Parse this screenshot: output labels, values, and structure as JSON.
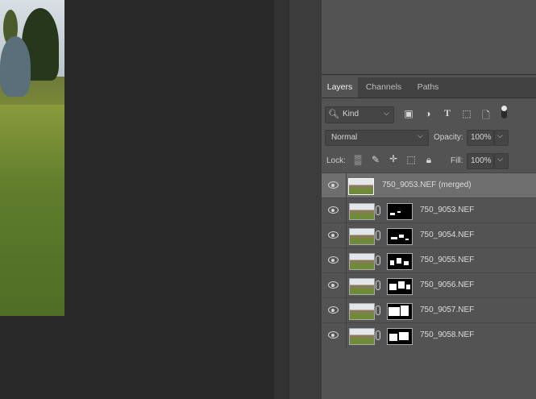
{
  "panel": {
    "tabs": [
      {
        "label": "Layers",
        "active": true
      },
      {
        "label": "Channels",
        "active": false
      },
      {
        "label": "Paths",
        "active": false
      }
    ],
    "filter": {
      "kind_label": "Kind"
    },
    "blend": {
      "mode": "Normal",
      "opacity_label": "Opacity:",
      "opacity_value": "100%"
    },
    "lock": {
      "label": "Lock:",
      "fill_label": "Fill:",
      "fill_value": "100%"
    },
    "layers": [
      {
        "name": "750_9053.NEF (merged)",
        "selected": true,
        "has_mask": false
      },
      {
        "name": "750_9053.NEF",
        "selected": false,
        "has_mask": true
      },
      {
        "name": "750_9054.NEF",
        "selected": false,
        "has_mask": true
      },
      {
        "name": "750_9055.NEF",
        "selected": false,
        "has_mask": true
      },
      {
        "name": "750_9056.NEF",
        "selected": false,
        "has_mask": true
      },
      {
        "name": "750_9057.NEF",
        "selected": false,
        "has_mask": true
      },
      {
        "name": "750_9058.NEF",
        "selected": false,
        "has_mask": true
      }
    ]
  },
  "icons": [
    "search-icon",
    "image-filter-icon",
    "adjustment-filter-icon",
    "type-filter-icon",
    "shape-filter-icon",
    "smart-object-filter-icon",
    "filter-toggle-icon",
    "lock-transparent-icon",
    "lock-image-icon",
    "lock-position-icon",
    "lock-artboard-icon",
    "lock-all-icon",
    "eye-icon",
    "link-icon",
    "chevron-down-icon"
  ]
}
